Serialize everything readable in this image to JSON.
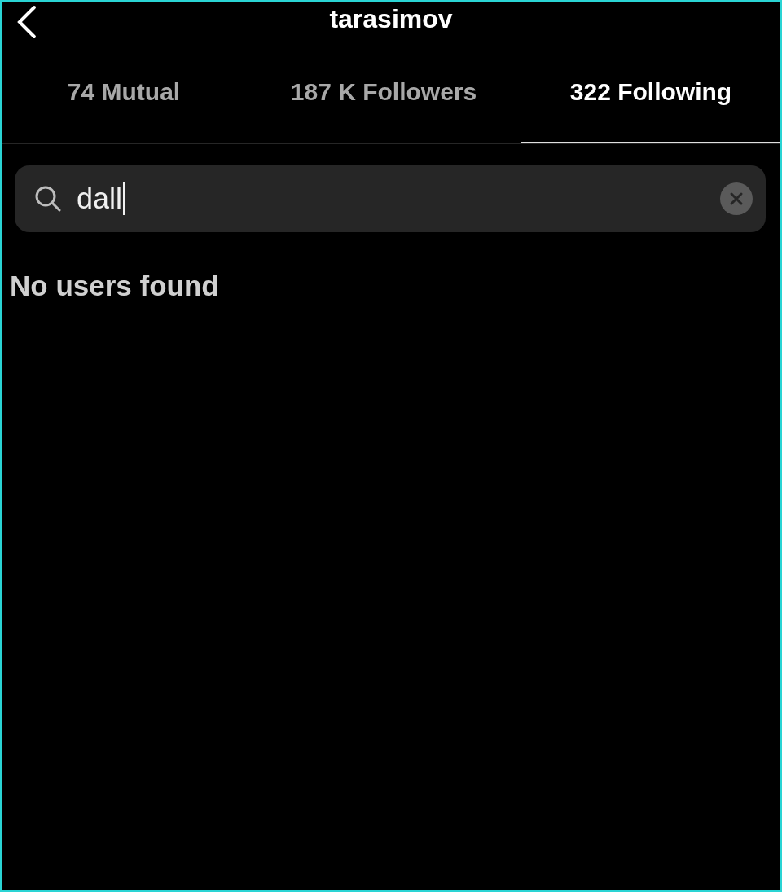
{
  "header": {
    "title": "tarasimov"
  },
  "tabs": [
    {
      "label": "74 Mutual",
      "selected": false
    },
    {
      "label": "187 K Followers",
      "selected": false
    },
    {
      "label": "322 Following",
      "selected": true
    }
  ],
  "search": {
    "value": "dall"
  },
  "message": "No users found"
}
